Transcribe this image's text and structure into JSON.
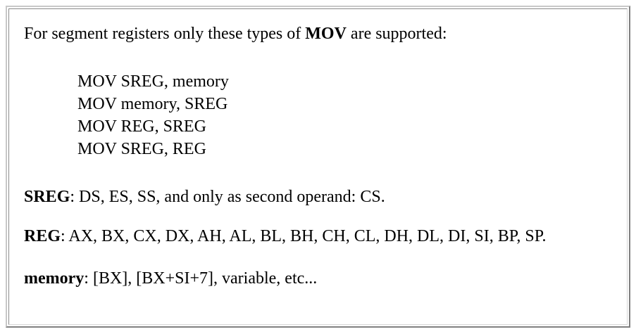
{
  "intro": {
    "prefix": "For segment registers only these types of ",
    "emphasis": "MOV",
    "suffix": " are supported:"
  },
  "code_lines": [
    "MOV SREG, memory",
    "MOV memory, SREG",
    "MOV REG, SREG",
    "MOV SREG, REG"
  ],
  "definitions": {
    "sreg": {
      "term": "SREG",
      "text": ": DS, ES, SS, and only as second operand: CS."
    },
    "reg": {
      "term": "REG",
      "text": ": AX, BX, CX, DX, AH, AL, BL, BH, CH, CL, DH, DL, DI, SI, BP, SP."
    },
    "memory": {
      "term": "memory",
      "text": ": [BX], [BX+SI+7], variable, etc..."
    }
  }
}
